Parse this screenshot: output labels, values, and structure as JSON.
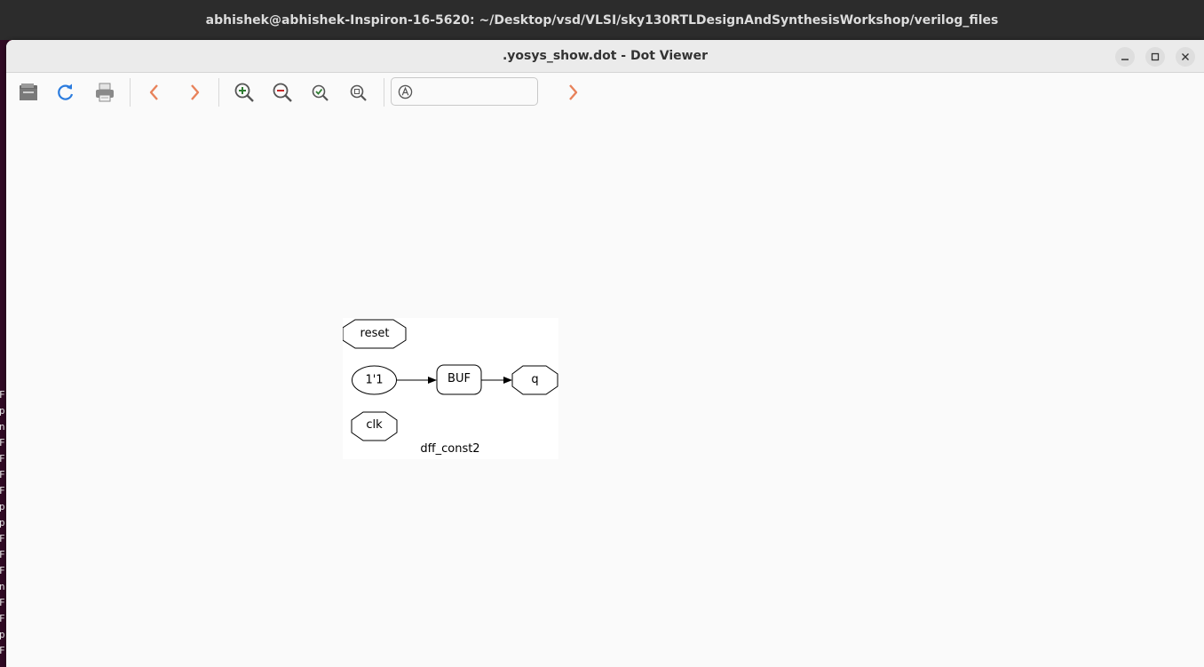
{
  "terminal": {
    "title": "abhishek@abhishek-Inspiron-16-5620: ~/Desktop/vsd/VLSI/sky130RTLDesignAndSynthesisWorkshop/verilog_files",
    "lines": [
      "F",
      "p",
      "n",
      "F",
      "F",
      "F",
      "F",
      "p",
      "p",
      "F",
      "F",
      "F",
      "n",
      "F",
      "F",
      "p",
      "F"
    ]
  },
  "window": {
    "title": ".yosys_show.dot - Dot Viewer"
  },
  "toolbar": {
    "buttons": [
      "open-icon",
      "reload-icon",
      "print-icon",
      "back-icon",
      "forward-icon",
      "zoom-in-icon",
      "zoom-out-icon",
      "zoom-fit-icon",
      "zoom-100-icon"
    ],
    "search": {
      "value": "",
      "placeholder": ""
    }
  },
  "graph": {
    "module_label": "dff_const2",
    "nodes": {
      "reset": "reset",
      "const": "1'1",
      "buf": "BUF",
      "q": "q",
      "clk": "clk"
    }
  },
  "colors": {
    "accent_blue": "#2a7bde",
    "nav_orange": "#e8825a",
    "zoom_in_green": "#2e7d32",
    "zoom_out_red": "#c62828",
    "terminal_bg": "#300a24"
  }
}
